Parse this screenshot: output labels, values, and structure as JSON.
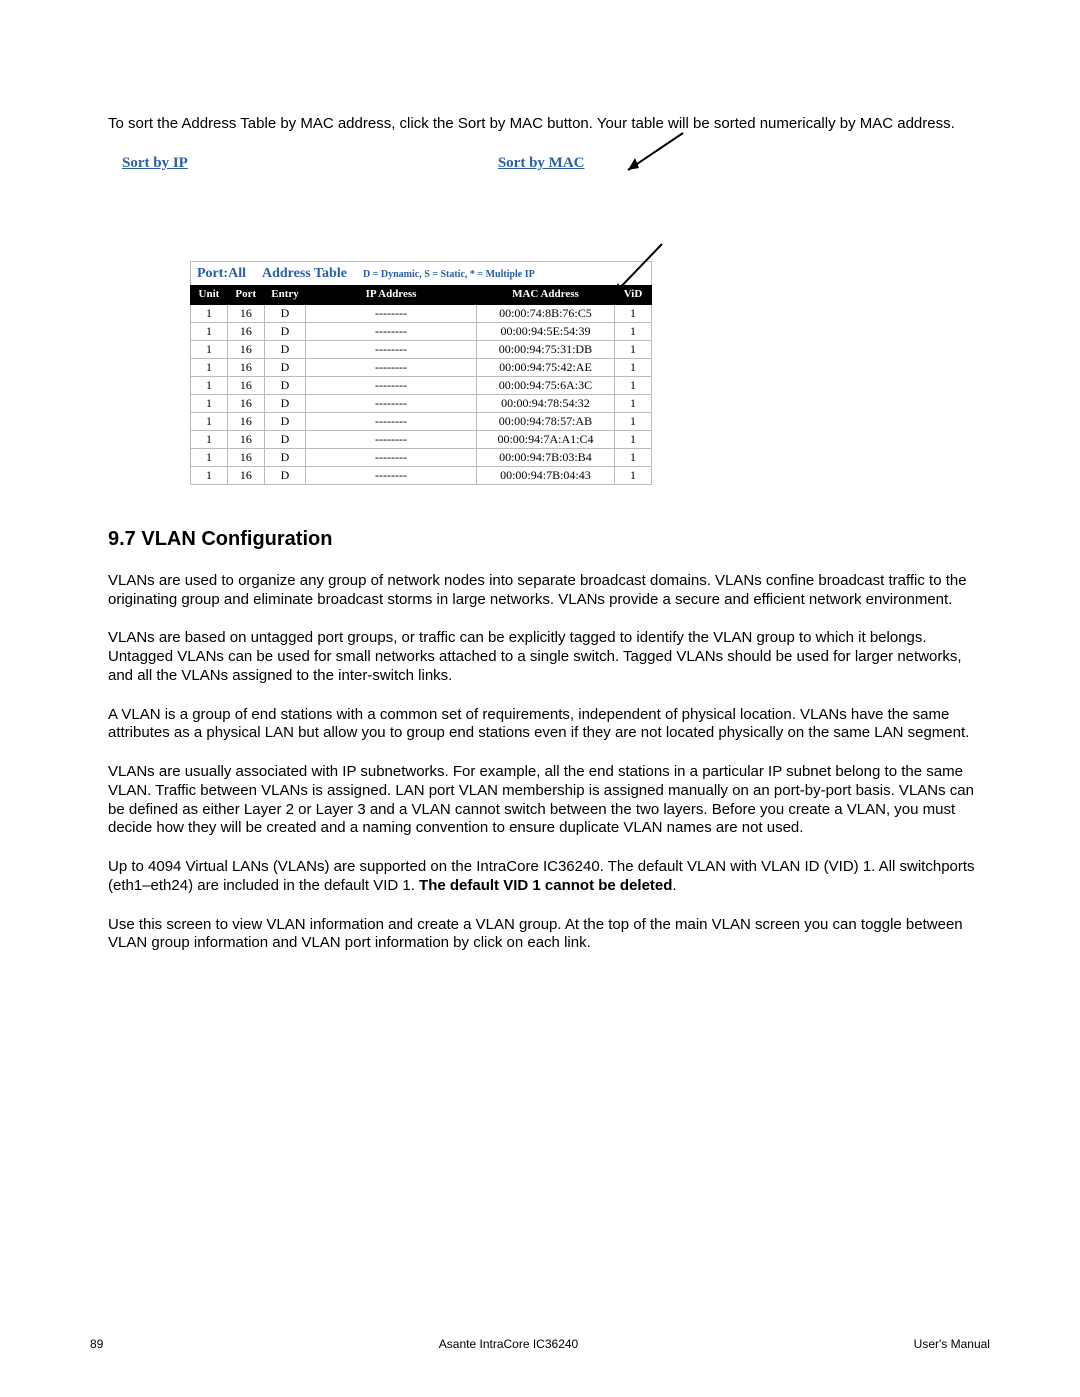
{
  "intro_text": "To sort the Address Table by MAC address, click the Sort by MAC button. Your table will be sorted numerically by MAC address.",
  "links": {
    "sort_by_ip": "Sort by IP",
    "sort_by_mac": "Sort by MAC"
  },
  "table": {
    "title_port": "Port:All",
    "title_name": "Address Table",
    "title_legend": "D = Dynamic,  S = Static,  * = Multiple IP",
    "headers": {
      "unit": "Unit",
      "port": "Port",
      "entry": "Entry",
      "ip": "IP Address",
      "mac": "MAC Address",
      "vid": "ViD"
    },
    "rows": [
      {
        "unit": "1",
        "port": "16",
        "entry": "D",
        "ip": "--------",
        "mac": "00:00:74:8B:76:C5",
        "vid": "1"
      },
      {
        "unit": "1",
        "port": "16",
        "entry": "D",
        "ip": "--------",
        "mac": "00:00:94:5E:54:39",
        "vid": "1"
      },
      {
        "unit": "1",
        "port": "16",
        "entry": "D",
        "ip": "--------",
        "mac": "00:00:94:75:31:DB",
        "vid": "1"
      },
      {
        "unit": "1",
        "port": "16",
        "entry": "D",
        "ip": "--------",
        "mac": "00:00:94:75:42:AE",
        "vid": "1"
      },
      {
        "unit": "1",
        "port": "16",
        "entry": "D",
        "ip": "--------",
        "mac": "00:00:94:75:6A:3C",
        "vid": "1"
      },
      {
        "unit": "1",
        "port": "16",
        "entry": "D",
        "ip": "--------",
        "mac": "00:00:94:78:54:32",
        "vid": "1"
      },
      {
        "unit": "1",
        "port": "16",
        "entry": "D",
        "ip": "--------",
        "mac": "00:00:94:78:57:AB",
        "vid": "1"
      },
      {
        "unit": "1",
        "port": "16",
        "entry": "D",
        "ip": "--------",
        "mac": "00:00:94:7A:A1:C4",
        "vid": "1"
      },
      {
        "unit": "1",
        "port": "16",
        "entry": "D",
        "ip": "--------",
        "mac": "00:00:94:7B:03:B4",
        "vid": "1"
      },
      {
        "unit": "1",
        "port": "16",
        "entry": "D",
        "ip": "--------",
        "mac": "00:00:94:7B:04:43",
        "vid": "1"
      }
    ]
  },
  "section": {
    "heading": "9.7 VLAN Configuration",
    "p1": "VLANs are used to organize any group of network nodes into separate broadcast domains. VLANs confine broadcast traffic to the originating group and eliminate broadcast storms in large networks. VLANs provide a secure and efficient network environment.",
    "p2": "VLANs are based on untagged port groups, or traffic can be explicitly tagged to identify the VLAN group to which it belongs. Untagged VLANs can be used for small networks attached to a single switch. Tagged VLANs should be used for larger networks, and all the VLANs assigned to the inter-switch links.",
    "p3": "A VLAN is a group of end stations with a common set of requirements, independent of physical location. VLANs have the same attributes as a physical LAN but allow you to group end stations even if they are not located physically on the same LAN segment.",
    "p4": "VLANs are usually associated with IP subnetworks. For example, all the end stations in a particular IP subnet belong to the same VLAN. Traffic between VLANs is assigned. LAN port VLAN membership is assigned manually on an port-by-port basis. VLANs can be defined as either Layer 2 or Layer 3 and a VLAN cannot switch between the two layers. Before you create a VLAN, you must decide how they will be created and a naming convention to ensure duplicate VLAN names are not used.",
    "p5a": "Up to 4094 Virtual LANs (VLANs) are supported on the IntraCore IC36240. The default VLAN with VLAN ID (VID) 1. All switchports (eth1–eth24) are included in the default VID 1. ",
    "p5b": "The default VID 1 cannot be deleted",
    "p5c": ".",
    "p6": "Use this screen to view VLAN information and create a VLAN group. At the top of the main VLAN screen you can toggle between VLAN group information and VLAN port information by click on each link."
  },
  "footer": {
    "page": "89",
    "center": "Asante IntraCore IC36240",
    "right": "User's Manual"
  }
}
